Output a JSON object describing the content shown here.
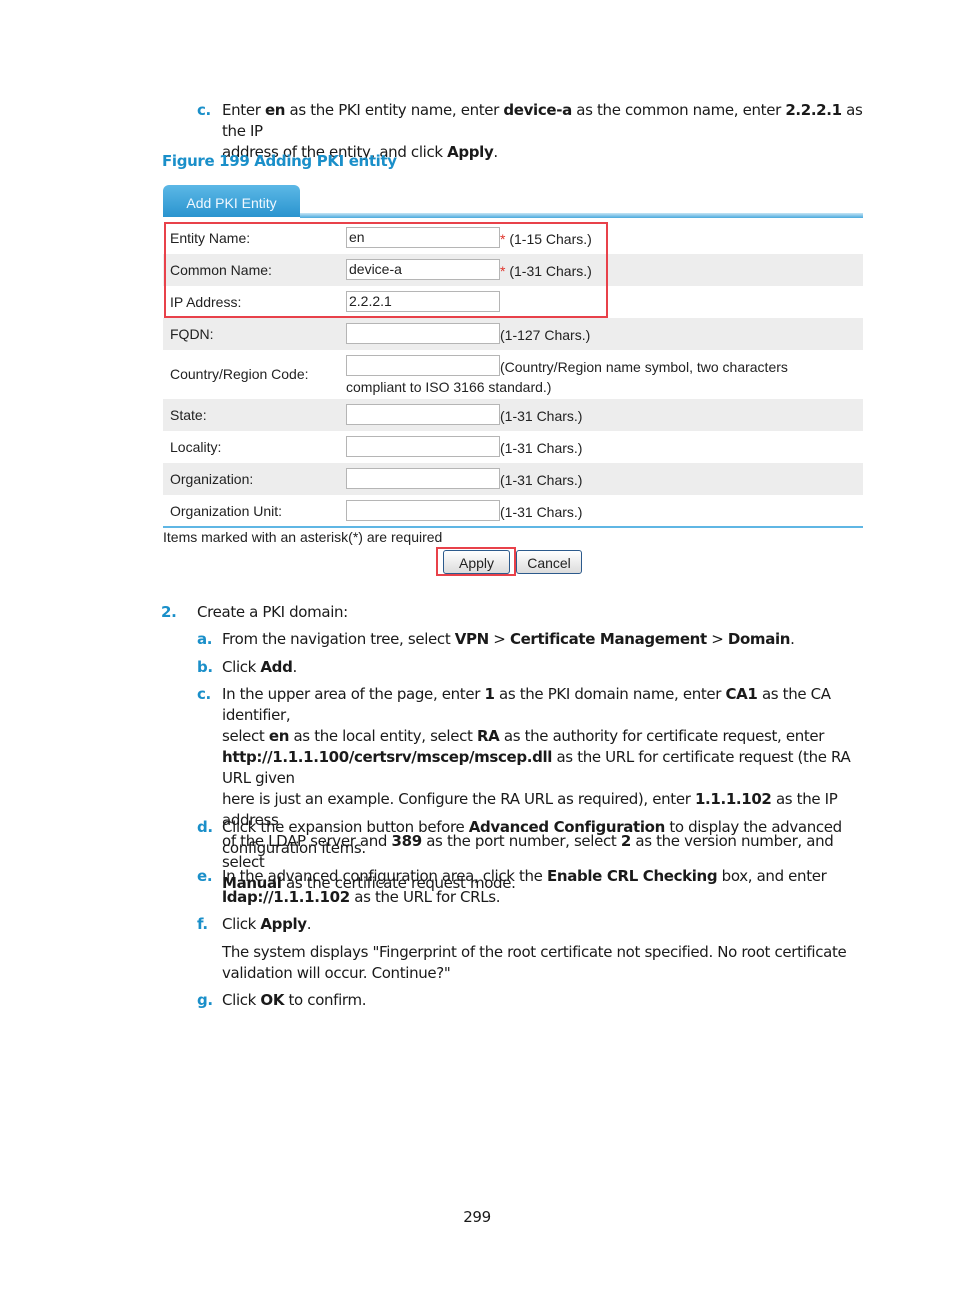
{
  "step1c": {
    "marker": "c.",
    "line1": [
      "Enter ",
      "en",
      " as the PKI entity name, enter ",
      "device-a",
      " as the common name, enter ",
      "2.2.2.1",
      " as the IP"
    ],
    "line2": [
      "address of the entity, and click ",
      "Apply",
      "."
    ]
  },
  "figure_caption": "Figure 199 Adding PKI entity",
  "form": {
    "tab_label": "Add PKI Entity",
    "rows": [
      {
        "label": "Entity Name:",
        "value": "en",
        "required": "*",
        "hint": " (1-15 Chars.)"
      },
      {
        "label": "Common Name:",
        "value": "device-a",
        "required": "*",
        "hint": " (1-31 Chars.)"
      },
      {
        "label": "IP Address:",
        "value": "2.2.2.1",
        "required": "",
        "hint": ""
      },
      {
        "label": "FQDN:",
        "value": "",
        "required": "",
        "hint": "(1-127 Chars.)"
      },
      {
        "label": "Country/Region Code:",
        "value": "",
        "required": "",
        "hint": "(Country/Region name symbol, two characters",
        "hint2": "compliant to ISO 3166 standard.)"
      },
      {
        "label": "State:",
        "value": "",
        "required": "",
        "hint": "(1-31 Chars.)"
      },
      {
        "label": "Locality:",
        "value": "",
        "required": "",
        "hint": "(1-31 Chars.)"
      },
      {
        "label": "Organization:",
        "value": "",
        "required": "",
        "hint": "(1-31 Chars.)"
      },
      {
        "label": "Organization Unit:",
        "value": "",
        "required": "",
        "hint": "(1-31 Chars.)"
      }
    ],
    "required_note": "Items marked with an asterisk(*) are required",
    "apply_label": "Apply",
    "cancel_label": "Cancel"
  },
  "step2": {
    "marker": "2.",
    "text": "Create a PKI domain:",
    "a": {
      "marker": "a.",
      "parts": [
        "From the navigation tree, select ",
        "VPN",
        " > ",
        "Certificate Management",
        " > ",
        "Domain",
        "."
      ]
    },
    "b": {
      "marker": "b.",
      "parts": [
        "Click ",
        "Add",
        "."
      ]
    },
    "c": {
      "marker": "c.",
      "l1": [
        "In the upper area of the page, enter ",
        "1",
        " as the PKI domain name, enter ",
        "CA1",
        " as the CA identifier,"
      ],
      "l2": [
        "select ",
        "en",
        " as the local entity, select ",
        "RA",
        " as the authority for certificate request, enter"
      ],
      "l3": [
        "http://1.1.1.100/certsrv/mscep/mscep.dll",
        " as the URL for certificate request (the RA URL given"
      ],
      "l4": [
        "here is just an example. Configure the RA URL as required), enter ",
        "1.1.1.102",
        " as the IP address"
      ],
      "l5": [
        "of the LDAP server and ",
        "389",
        " as the port number, select ",
        "2",
        " as the version number, and select"
      ],
      "l6": [
        "Manual",
        " as the certificate request mode."
      ]
    },
    "d": {
      "marker": "d.",
      "l1": [
        "Click the expansion button before ",
        "Advanced Configuration",
        " to display the advanced"
      ],
      "l2": "configuration items."
    },
    "e": {
      "marker": "e.",
      "l1": [
        "In the advanced configuration area, click the ",
        "Enable CRL Checking",
        " box, and enter"
      ],
      "l2": [
        "ldap://1.1.1.102",
        " as the URL for CRLs."
      ]
    },
    "f": {
      "marker": "f.",
      "parts": [
        "Click ",
        "Apply",
        "."
      ],
      "note1": "The system displays \"Fingerprint of the root certificate not specified. No root certificate",
      "note2": "validation will occur. Continue?\""
    },
    "g": {
      "marker": "g.",
      "parts": [
        "Click ",
        "OK",
        " to confirm."
      ]
    }
  },
  "page_number": "299"
}
